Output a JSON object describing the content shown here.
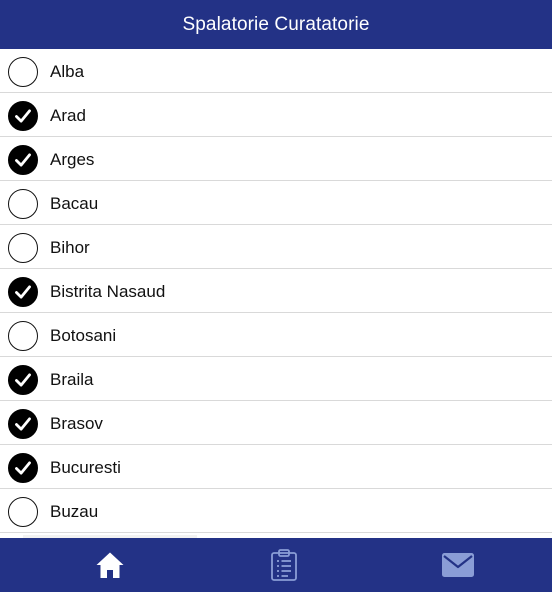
{
  "header": {
    "title": "Spalatorie Curatatorie"
  },
  "colors": {
    "primary": "#233286",
    "checked": "#000000",
    "tab_active": "#ffffff",
    "tab_inactive": "#8a9dd6"
  },
  "counties": [
    {
      "label": "Alba",
      "checked": false
    },
    {
      "label": "Arad",
      "checked": true
    },
    {
      "label": "Arges",
      "checked": true
    },
    {
      "label": "Bacau",
      "checked": false
    },
    {
      "label": "Bihor",
      "checked": false
    },
    {
      "label": "Bistrita Nasaud",
      "checked": true
    },
    {
      "label": "Botosani",
      "checked": false
    },
    {
      "label": "Braila",
      "checked": true
    },
    {
      "label": "Brasov",
      "checked": true
    },
    {
      "label": "Bucuresti",
      "checked": true
    },
    {
      "label": "Buzau",
      "checked": false
    }
  ],
  "tabbar": {
    "tabs": [
      {
        "icon": "home-icon",
        "active": true
      },
      {
        "icon": "clipboard-icon",
        "active": false
      },
      {
        "icon": "mail-icon",
        "active": false
      }
    ]
  }
}
